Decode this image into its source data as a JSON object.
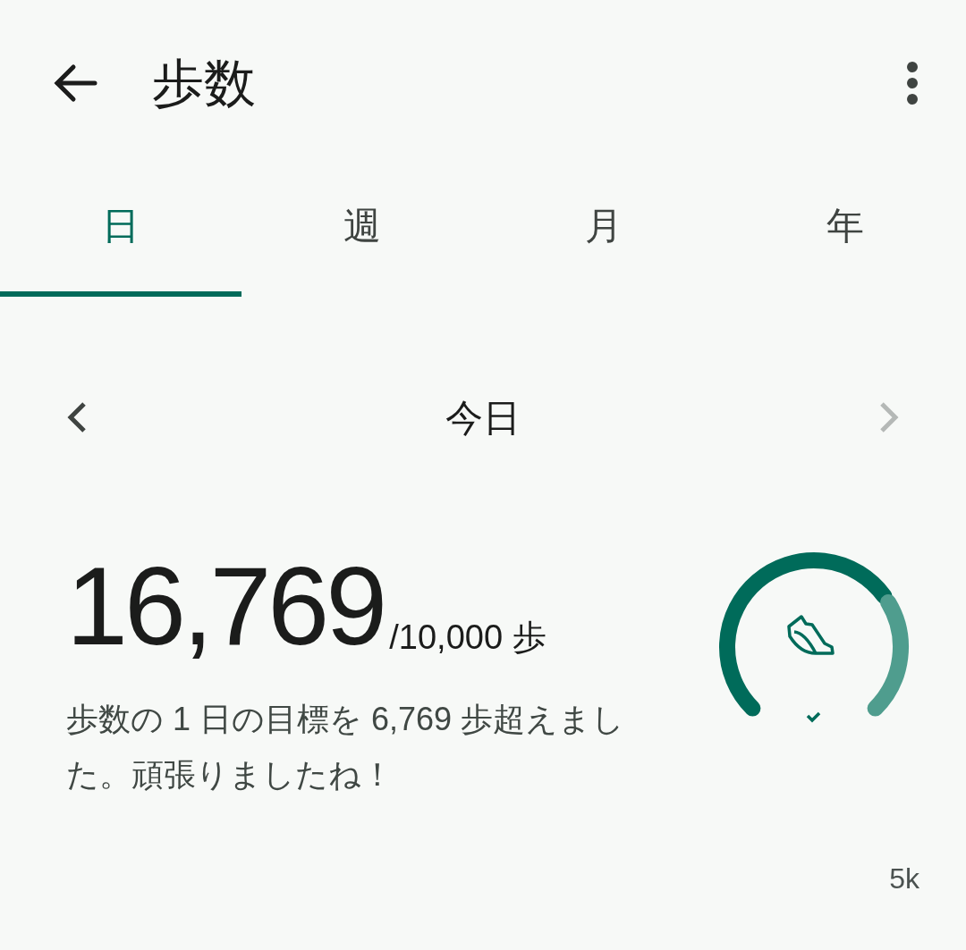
{
  "header": {
    "title": "歩数"
  },
  "tabs": [
    {
      "label": "日",
      "selected": true
    },
    {
      "label": "週",
      "selected": false
    },
    {
      "label": "月",
      "selected": false
    },
    {
      "label": "年",
      "selected": false
    }
  ],
  "date_nav": {
    "label": "今日",
    "next_disabled": true
  },
  "summary": {
    "steps": "16,769",
    "goal": "/10,000 歩",
    "message": "歩数の 1 日の目標を 6,769 歩超えました。頑張りましたね！"
  },
  "gauge": {
    "goal_met": true
  },
  "chart_axis_label": "5k"
}
